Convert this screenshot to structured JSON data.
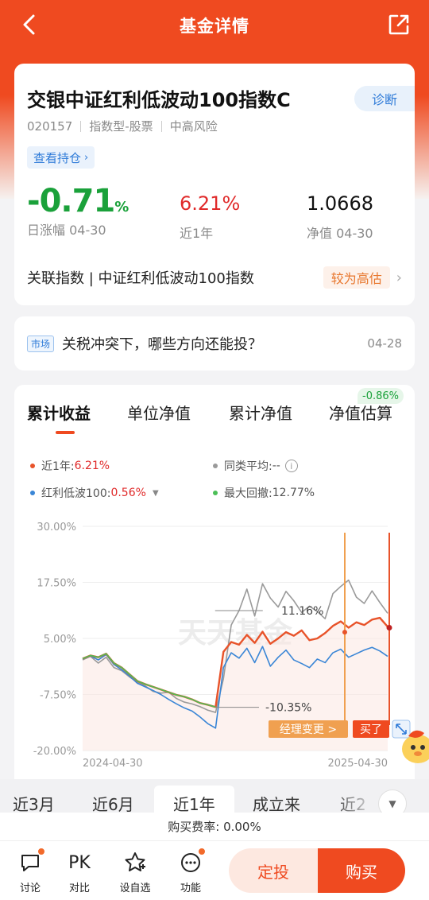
{
  "header": {
    "title": "基金详情"
  },
  "fund": {
    "name": "交银中证红利低波动100指数C",
    "code": "020157",
    "type": "指数型-股票",
    "risk": "中高风险",
    "diagnose_label": "诊断",
    "holdings_label": "查看持仓",
    "daily_change_value": "-0.71",
    "daily_change_unit": "%",
    "daily_change_label": "日涨幅 04-30",
    "one_year_value": "6.21%",
    "one_year_label": "近1年",
    "nav_value": "1.0668",
    "nav_label": "净值 04-30",
    "index_text": "关联指数 | 中证红利低波动100指数",
    "index_badge": "较为高估"
  },
  "news": {
    "tag": "市场",
    "title": "关税冲突下，哪些方向还能投？",
    "date": "04-28"
  },
  "chart_tabs": {
    "items": [
      "累计收益",
      "单位净值",
      "累计净值",
      "净值估算"
    ],
    "active_index": 0,
    "estimate_badge": "-0.86%"
  },
  "legend": {
    "fund_label": "近1年:",
    "fund_value": "6.21%",
    "peer_label": "同类平均:",
    "peer_value": "--",
    "index_label": "红利低波100:",
    "index_value": "0.56%",
    "drawdown_label": "最大回撤:",
    "drawdown_value": "12.77%"
  },
  "chart_data": {
    "type": "line",
    "y_ticks": [
      "30.00%",
      "17.50%",
      "5.00%",
      "-7.50%",
      "-20.00%"
    ],
    "ylim": [
      -20,
      30
    ],
    "x_start_label": "2024-04-30",
    "x_end_label": "2025-04-30",
    "annotations": {
      "peak_label": "11.16%",
      "trough_label": "-10.35%",
      "manager_change_label": "经理变更 >",
      "bought_label": "买了"
    },
    "watermark": "天天基金",
    "series": [
      {
        "name": "近1年",
        "color": "#e8532a",
        "values": [
          0.5,
          1.2,
          0.8,
          1.6,
          -0.5,
          -1.5,
          -3.0,
          -4.5,
          -5.2,
          -5.8,
          -6.4,
          -7.0,
          -7.6,
          -8.0,
          -8.6,
          -9.4,
          -9.8,
          -10.3,
          2.0,
          4.2,
          3.6,
          5.8,
          4.0,
          6.5,
          3.8,
          5.0,
          6.4,
          5.6,
          6.8,
          4.6,
          5.0,
          6.2,
          7.8,
          8.8,
          7.4,
          8.6,
          8.0,
          9.2,
          9.6,
          7.6
        ]
      },
      {
        "name": "同类平均",
        "color": "#9a9a9a",
        "values": [
          0.2,
          1.0,
          -0.5,
          0.8,
          -1.5,
          -2.2,
          -3.6,
          -4.8,
          -5.6,
          -6.8,
          -7.2,
          -7.0,
          -8.4,
          -9.2,
          -9.6,
          -10.2,
          -11.0,
          -11.5,
          -4.0,
          8.0,
          11.2,
          16.0,
          10.0,
          17.2,
          14.0,
          12.0,
          15.5,
          13.4,
          10.8,
          12.2,
          11.0,
          9.4,
          15.0,
          16.6,
          18.0,
          14.2,
          12.8,
          15.6,
          13.0,
          10.6
        ]
      },
      {
        "name": "红利低波100",
        "color": "#3a86d6",
        "values": [
          0.4,
          1.1,
          0.2,
          1.4,
          -0.8,
          -2.0,
          -3.4,
          -5.0,
          -5.8,
          -6.6,
          -7.5,
          -8.6,
          -9.6,
          -10.5,
          -11.2,
          -12.5,
          -14.0,
          -15.0,
          -1.5,
          1.8,
          0.6,
          2.8,
          -0.4,
          3.2,
          -1.2,
          0.8,
          2.4,
          0.2,
          -0.6,
          -1.5,
          0.4,
          -0.4,
          1.8,
          2.6,
          0.8,
          1.6,
          2.4,
          3.0,
          2.2,
          1.0
        ]
      },
      {
        "name": "最大回撤",
        "color": "#4cbf57",
        "values": [
          0.5,
          1.2,
          0.8,
          1.6,
          -0.5,
          -1.5,
          -3.0,
          -4.5,
          -5.2,
          -5.8,
          -6.4,
          -7.0,
          -7.6,
          -8.0,
          -8.6,
          -9.4,
          -9.8,
          -10.3
        ]
      }
    ]
  },
  "periods": {
    "items": [
      "近3月",
      "近6月",
      "近1年",
      "成立来",
      "近2"
    ],
    "active_index": 2
  },
  "fee": {
    "text": "购买费率: 0.00%"
  },
  "bottom": {
    "discuss": "讨论",
    "pk_icon_text": "PK",
    "compare": "对比",
    "watchlist": "设自选",
    "functions": "功能",
    "dingtou": "定投",
    "buy": "购买"
  }
}
